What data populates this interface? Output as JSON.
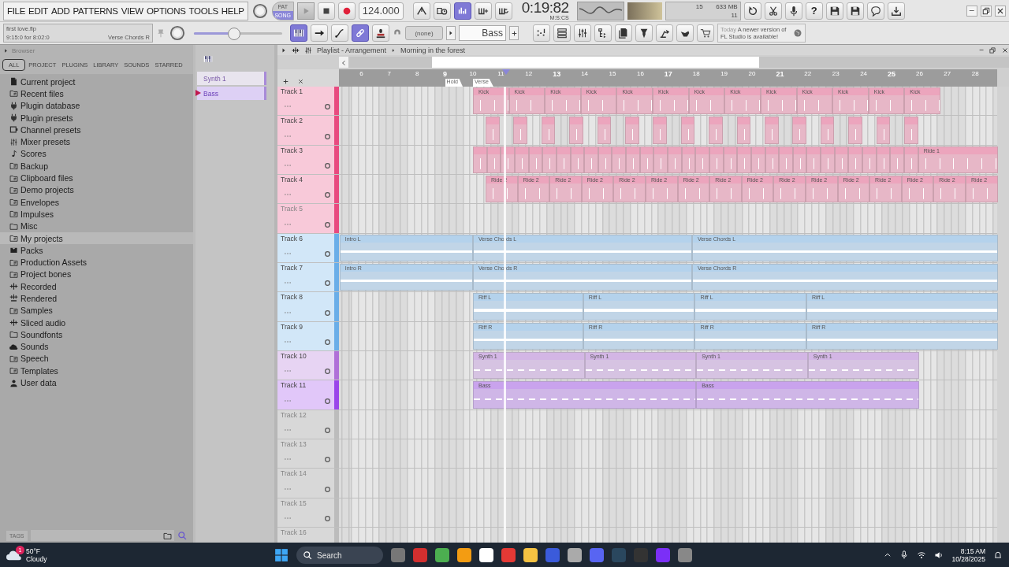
{
  "menu": [
    "FILE",
    "EDIT",
    "ADD",
    "PATTERNS",
    "VIEW",
    "OPTIONS",
    "TOOLS",
    "HELP"
  ],
  "mode": [
    {
      "label": "PAT",
      "selected": false
    },
    {
      "label": "SONG",
      "selected": true
    }
  ],
  "tempo": "124.000",
  "time": {
    "value": "0:19:82",
    "unit": "M:S:CS"
  },
  "cpu": {
    "value": "15",
    "memory": "633 MB",
    "polyphony": "11"
  },
  "help_button": "?",
  "project": {
    "file": "first love.flp",
    "position": "9:15:0 for 8:02:0",
    "hint": "Verse Chords R"
  },
  "master_volume": {
    "level": 0.45
  },
  "pattern_filter": "(none)",
  "pattern": "Bass",
  "news": {
    "date": "Today",
    "message": "A newer version of FL Studio is available!"
  },
  "browser": {
    "title": "Browser",
    "tabs": [
      {
        "label": "ALL",
        "selected": true
      },
      {
        "label": "PROJECT",
        "selected": false
      },
      {
        "label": "PLUGINS",
        "selected": false
      },
      {
        "label": "LIBRARY",
        "selected": false
      },
      {
        "label": "SOUNDS",
        "selected": false
      },
      {
        "label": "STARRED",
        "selected": false
      }
    ],
    "items": [
      {
        "label": "Current project",
        "kind": "file",
        "selected": false
      },
      {
        "label": "Recent files",
        "kind": "sync",
        "selected": false
      },
      {
        "label": "Plugin database",
        "kind": "plug",
        "selected": false
      },
      {
        "label": "Plugin presets",
        "kind": "plug",
        "selected": false
      },
      {
        "label": "Channel presets",
        "kind": "preset",
        "selected": false
      },
      {
        "label": "Mixer presets",
        "kind": "mixer",
        "selected": false
      },
      {
        "label": "Scores",
        "kind": "note",
        "selected": false
      },
      {
        "label": "Backup",
        "kind": "sync",
        "selected": false
      },
      {
        "label": "Clipboard files",
        "kind": "sync",
        "selected": false
      },
      {
        "label": "Demo projects",
        "kind": "sync",
        "selected": false
      },
      {
        "label": "Envelopes",
        "kind": "sync",
        "selected": false
      },
      {
        "label": "Impulses",
        "kind": "sync",
        "selected": false
      },
      {
        "label": "Misc",
        "kind": "folder",
        "selected": false
      },
      {
        "label": "My projects",
        "kind": "sync",
        "selected": true
      },
      {
        "label": "Packs",
        "kind": "packs",
        "selected": false
      },
      {
        "label": "Production Assets",
        "kind": "sync",
        "selected": false
      },
      {
        "label": "Project bones",
        "kind": "sync",
        "selected": false
      },
      {
        "label": "Recorded",
        "kind": "wave",
        "selected": false
      },
      {
        "label": "Rendered",
        "kind": "render",
        "selected": false
      },
      {
        "label": "Samples",
        "kind": "sync",
        "selected": false
      },
      {
        "label": "Sliced audio",
        "kind": "wave",
        "selected": false
      },
      {
        "label": "Soundfonts",
        "kind": "folder",
        "selected": false
      },
      {
        "label": "Sounds",
        "kind": "cloud",
        "selected": false
      },
      {
        "label": "Speech",
        "kind": "sync",
        "selected": false
      },
      {
        "label": "Templates",
        "kind": "sync",
        "selected": false
      },
      {
        "label": "User data",
        "kind": "user",
        "selected": false
      }
    ],
    "tags_label": "TAGS"
  },
  "picker": [
    {
      "label": "Synth 1",
      "selected": false
    },
    {
      "label": "Bass",
      "selected": true
    }
  ],
  "playlist": {
    "title": "Playlist - Arrangement",
    "arrangement": "Morning in the forest",
    "ruler": [
      "6",
      "7",
      "8",
      "9",
      "10",
      "11",
      "12",
      "13",
      "14",
      "15",
      "16",
      "17",
      "18",
      "19",
      "20",
      "21",
      "22",
      "23",
      "24",
      "25",
      "26",
      "27",
      "28"
    ],
    "markers": [
      "Hold",
      "Verse"
    ],
    "tracks": [
      {
        "name": "Track 1",
        "color": "#e84a7f",
        "kind": "drum",
        "empty": false,
        "clips": [
          {
            "label": "Kick"
          },
          {
            "label": "Kick"
          },
          {
            "label": "Kick"
          },
          {
            "label": "Kick"
          },
          {
            "label": "Kick"
          },
          {
            "label": "Kick"
          },
          {
            "label": "Kick"
          },
          {
            "label": "Kick"
          },
          {
            "label": "Kick"
          },
          {
            "label": "Kick"
          },
          {
            "label": "Kick"
          },
          {
            "label": "Kick"
          },
          {
            "label": "Kick"
          }
        ]
      },
      {
        "name": "Track 2",
        "color": "#e84a7f",
        "kind": "drum",
        "empty": false
      },
      {
        "name": "Track 3",
        "color": "#e84a7f",
        "kind": "drum",
        "empty": false,
        "clips": [
          {
            "label": "Ride 1"
          }
        ]
      },
      {
        "name": "Track 4",
        "color": "#e84a7f",
        "kind": "drum",
        "empty": false,
        "clips": [
          {
            "label": "Ride 2"
          },
          {
            "label": "Ride 2"
          },
          {
            "label": "Ride 2"
          },
          {
            "label": "Ride 2"
          },
          {
            "label": "Ride 2"
          },
          {
            "label": "Ride 2"
          },
          {
            "label": "Ride 2"
          },
          {
            "label": "Ride 2"
          },
          {
            "label": "Ride 2"
          },
          {
            "label": "Ride 2"
          },
          {
            "label": "Ride 2"
          },
          {
            "label": "Ride 2"
          },
          {
            "label": "Ride 2"
          },
          {
            "label": "Ride 2"
          },
          {
            "label": "Ride 2"
          },
          {
            "label": "Ride 2"
          }
        ]
      },
      {
        "name": "Track 5",
        "color": "#e84a7f",
        "empty": true
      },
      {
        "name": "Track 6",
        "color": "#6aaee8",
        "kind": "audio",
        "empty": false,
        "clips": [
          {
            "label": "Intro L"
          },
          {
            "label": "Verse Chords L"
          },
          {
            "label": "Verse Chords L"
          }
        ]
      },
      {
        "name": "Track 7",
        "color": "#6aaee8",
        "kind": "audio",
        "empty": false,
        "clips": [
          {
            "label": "Intro R"
          },
          {
            "label": "Verse Chords R"
          },
          {
            "label": "Verse Chords R"
          }
        ]
      },
      {
        "name": "Track 8",
        "color": "#6aaee8",
        "kind": "audio",
        "empty": false,
        "clips": [
          {
            "label": "Riff L"
          },
          {
            "label": "Riff L"
          },
          {
            "label": "Riff L"
          },
          {
            "label": "Riff L"
          }
        ]
      },
      {
        "name": "Track 9",
        "color": "#6aaee8",
        "kind": "audio",
        "empty": false,
        "clips": [
          {
            "label": "Riff R"
          },
          {
            "label": "Riff R"
          },
          {
            "label": "Riff R"
          },
          {
            "label": "Riff R"
          }
        ]
      },
      {
        "name": "Track 10",
        "color": "#b070d8",
        "kind": "pattern",
        "empty": false,
        "clips": [
          {
            "label": "Synth 1"
          },
          {
            "label": "Synth 1"
          },
          {
            "label": "Synth 1"
          },
          {
            "label": "Synth 1"
          }
        ]
      },
      {
        "name": "Track 11",
        "color": "#9a45ea",
        "kind": "pattern",
        "empty": false,
        "clips": [
          {
            "label": "Bass"
          },
          {
            "label": "Bass"
          }
        ]
      },
      {
        "name": "Track 12",
        "empty": true
      },
      {
        "name": "Track 13",
        "empty": true
      },
      {
        "name": "Track 14",
        "empty": true
      },
      {
        "name": "Track 15",
        "empty": true
      },
      {
        "name": "Track 16",
        "empty": true
      }
    ]
  },
  "taskbar": {
    "weather": {
      "temp": "50°F",
      "condition": "Cloudy",
      "badge": "1"
    },
    "search": {
      "placeholder": "Search"
    },
    "time": "8:15 AM",
    "date": "10/28/2025"
  }
}
